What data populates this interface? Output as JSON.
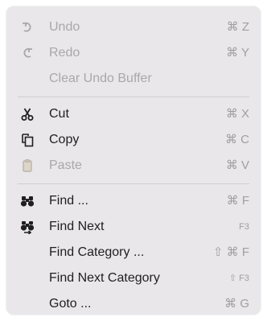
{
  "menu": {
    "items": [
      {
        "label": "Undo",
        "shortcut": "⌘ Z",
        "icon": "undo-icon",
        "disabled": true
      },
      {
        "label": "Redo",
        "shortcut": "⌘ Y",
        "icon": "redo-icon",
        "disabled": true
      },
      {
        "label": "Clear Undo Buffer",
        "shortcut": "",
        "icon": "",
        "disabled": true
      },
      {
        "label": "Cut",
        "shortcut": "⌘ X",
        "icon": "scissors-icon",
        "disabled": false
      },
      {
        "label": "Copy",
        "shortcut": "⌘ C",
        "icon": "copy-icon",
        "disabled": false
      },
      {
        "label": "Paste",
        "shortcut": "⌘ V",
        "icon": "clipboard-icon",
        "disabled": true
      },
      {
        "label": "Find ...",
        "shortcut": "⌘ F",
        "icon": "binoculars-icon",
        "disabled": false
      },
      {
        "label": "Find Next",
        "shortcut": "F3",
        "icon": "binoculars-next-icon",
        "disabled": false
      },
      {
        "label": "Find Category ...",
        "shortcut": "⇧ ⌘ F",
        "icon": "",
        "disabled": false
      },
      {
        "label": "Find Next Category",
        "shortcut": "⇧ F3",
        "icon": "",
        "disabled": false
      },
      {
        "label": "Goto ...",
        "shortcut": "⌘ G",
        "icon": "",
        "disabled": false
      }
    ]
  },
  "colors": {
    "menu_background": "#e9e7ea",
    "text_enabled": "#1f1f1f",
    "text_disabled": "#a9a7ab",
    "shortcut": "#a09ea3",
    "separator": "#cfcdd1"
  }
}
